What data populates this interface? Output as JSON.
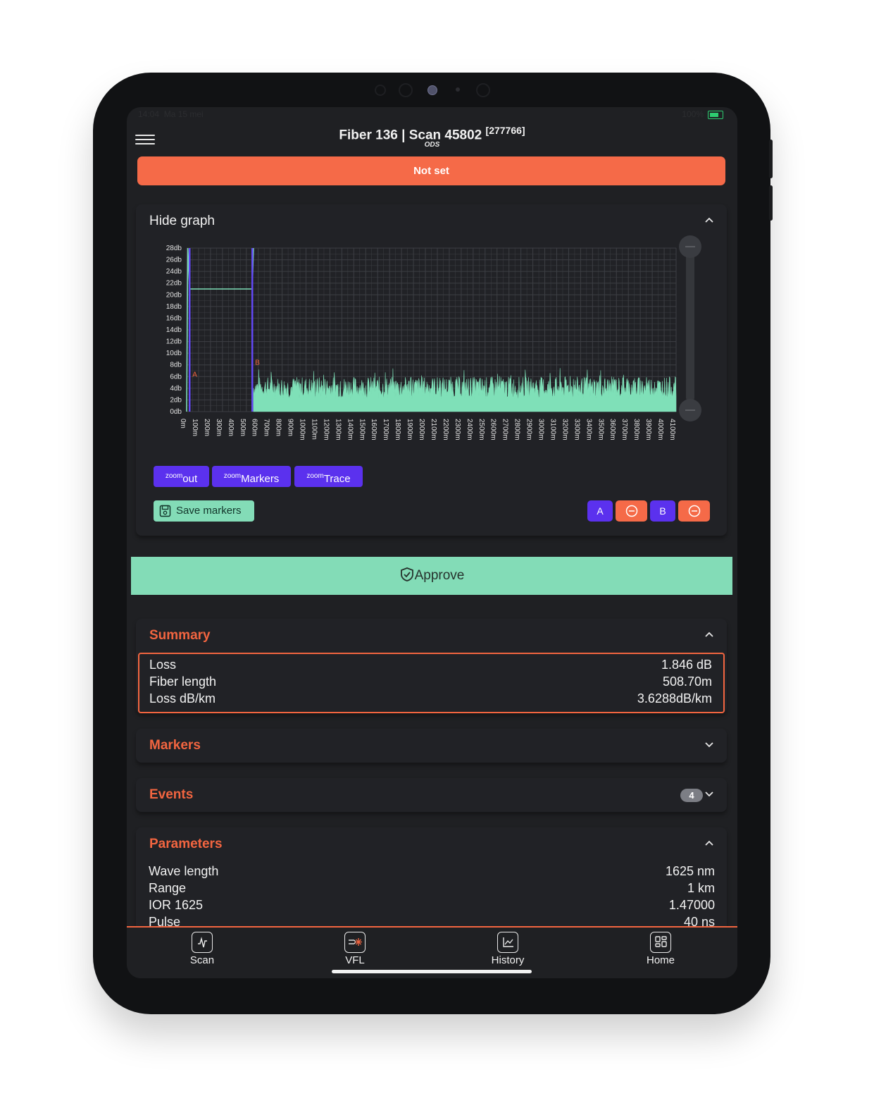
{
  "statusbar": {
    "time": "14:04",
    "date": "Ma 15 mei",
    "battery": "100%"
  },
  "header": {
    "title": "Fiber 136 | Scan 45802",
    "scan_ref": "[277766]",
    "subtitle": "ODS",
    "status_button": "Not set"
  },
  "graph": {
    "toggle_label": "Hide graph",
    "zoom_buttons": [
      {
        "sup": "zoom",
        "label": "out"
      },
      {
        "sup": "zoom",
        "label": "Markers"
      },
      {
        "sup": "zoom",
        "label": "Trace"
      }
    ],
    "save_markers": "Save markers",
    "marker_a": "A",
    "marker_b": "B"
  },
  "chart_data": {
    "type": "line",
    "y_ticks": [
      "28db",
      "26db",
      "24db",
      "22db",
      "20db",
      "18db",
      "16db",
      "14db",
      "12db",
      "10db",
      "8db",
      "6db",
      "4db",
      "2db",
      "0db"
    ],
    "x_ticks": [
      "0m",
      "100m",
      "200m",
      "300m",
      "400m",
      "500m",
      "600m",
      "700m",
      "800m",
      "900m",
      "1000m",
      "1100m",
      "1200m",
      "1300m",
      "1400m",
      "1500m",
      "1600m",
      "1700m",
      "1800m",
      "1900m",
      "2000m",
      "2100m",
      "2200m",
      "2300m",
      "2400m",
      "2500m",
      "2600m",
      "2700m",
      "2800m",
      "2900m",
      "3000m",
      "3100m",
      "3200m",
      "3300m",
      "3400m",
      "3500m",
      "3600m",
      "3700m",
      "3800m",
      "3900m",
      "4000m",
      "4100m"
    ],
    "ylim": [
      0,
      28
    ],
    "xlim": [
      0,
      4100
    ],
    "markers": [
      {
        "name": "A",
        "x": 25
      },
      {
        "name": "B",
        "x": 550
      }
    ],
    "trace_segments": [
      {
        "x": [
          0,
          10,
          25,
          550,
          560
        ],
        "y": [
          0,
          28,
          21,
          21,
          28
        ]
      }
    ],
    "noise": {
      "x_start": 560,
      "x_end": 4100,
      "y_min": 0,
      "y_max": 7.5
    },
    "colors": {
      "trace": "#7fe0b8",
      "noise": "#7fe0b8",
      "marker": "#6248f5",
      "grid": "#3d3f44"
    }
  },
  "approve_label": "Approve",
  "summary": {
    "title": "Summary",
    "rows": [
      {
        "key": "Loss",
        "value": "1.846 dB"
      },
      {
        "key": "Fiber length",
        "value": "508.70m"
      },
      {
        "key": "Loss dB/km",
        "value": "3.6288dB/km"
      }
    ]
  },
  "markers_section": {
    "title": "Markers"
  },
  "events_section": {
    "title": "Events",
    "count": "4"
  },
  "parameters": {
    "title": "Parameters",
    "rows": [
      {
        "key": "Wave length",
        "value": "1625 nm"
      },
      {
        "key": "Range",
        "value": "1 km"
      },
      {
        "key": "IOR 1625",
        "value": "1.47000"
      },
      {
        "key": "Pulse",
        "value": "40 ns"
      }
    ]
  },
  "nav": [
    {
      "label": "Scan",
      "icon": "scan-icon"
    },
    {
      "label": "VFL",
      "icon": "vfl-icon"
    },
    {
      "label": "History",
      "icon": "history-icon"
    },
    {
      "label": "Home",
      "icon": "home-icon"
    }
  ],
  "colors": {
    "accent": "#f26540",
    "primary": "#5b31ee",
    "success": "#83dcb7",
    "surface": "#212226"
  }
}
